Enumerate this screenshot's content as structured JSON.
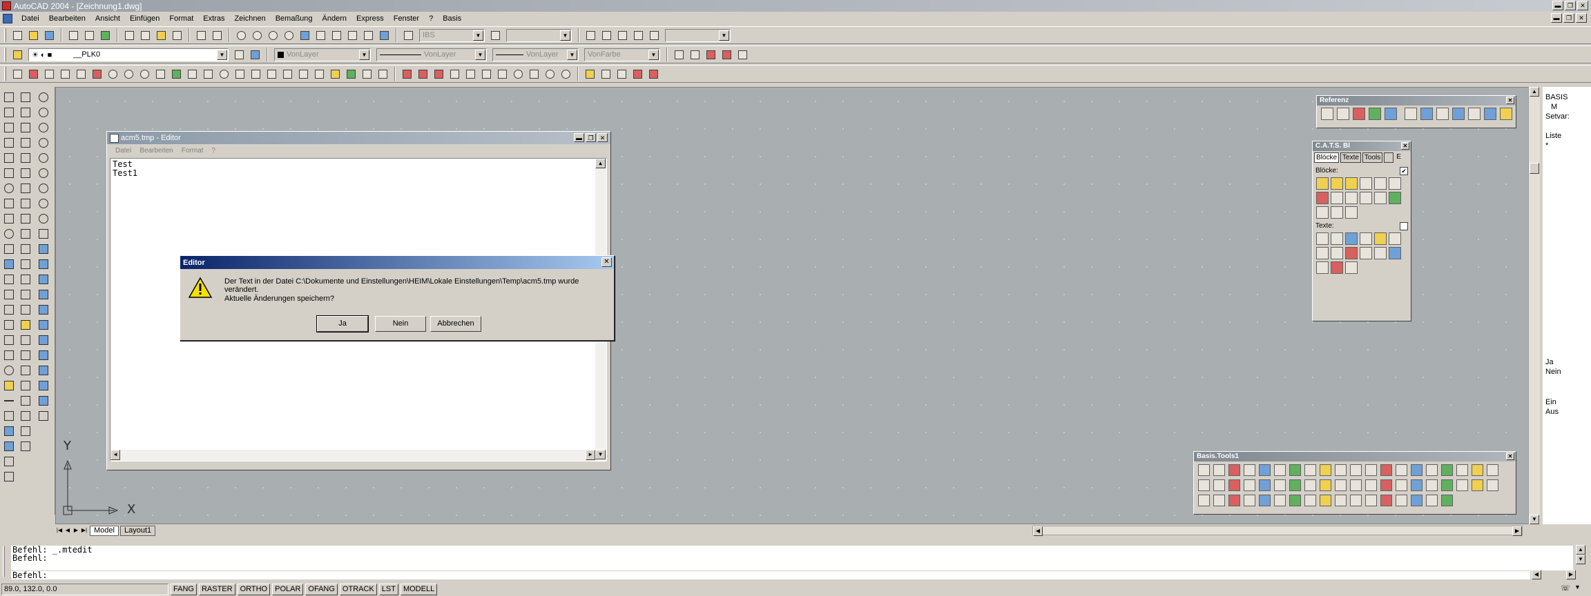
{
  "window": {
    "title": "AutoCAD 2004 - [Zeichnung1.dwg]",
    "controls": [
      "▬",
      "❐",
      "✕"
    ]
  },
  "menu": {
    "items": [
      "Datei",
      "Bearbeiten",
      "Ansicht",
      "Einfügen",
      "Format",
      "Extras",
      "Zeichnen",
      "Bemaßung",
      "Ändern",
      "Express",
      "Fenster",
      "?",
      "Basis"
    ]
  },
  "toolbars": {
    "text_style": "IBS",
    "layer": "__PLK0",
    "color": "VonLayer",
    "linetype": "VonLayer",
    "lineweight": "VonLayer",
    "plotstyle": "VonFarbe"
  },
  "editor": {
    "title": "acm5.tmp - Editor",
    "menu": [
      "Datei",
      "Bearbeiten",
      "Format",
      "?"
    ],
    "lines": [
      "Test",
      "Test1"
    ]
  },
  "dialog": {
    "title": "Editor",
    "message": "Der Text in der Datei C:\\Dokumente und Einstellungen\\HEIM\\Lokale Einstellungen\\Temp\\acm5.tmp wurde verändert.",
    "question": "Aktuelle Änderungen speichern?",
    "buttons": {
      "yes": "Ja",
      "no": "Nein",
      "cancel": "Abbrechen"
    }
  },
  "palettes": {
    "referenz": {
      "title": "Referenz"
    },
    "cats": {
      "title": "C.A.T.S. Bl",
      "tabs": [
        "Blöcke",
        "Texte",
        "Tools",
        "",
        "E"
      ],
      "bloecke_label": "Blöcke:",
      "texte_label": "Texte:"
    },
    "basis_tools": {
      "title": "Basis.Tools1"
    }
  },
  "right_panel": {
    "lines": [
      "BASIS",
      "M",
      "Setvar:",
      "",
      "Liste",
      "*"
    ],
    "yn": [
      "Ja",
      "Nein"
    ],
    "onoff": [
      "Ein",
      "Aus"
    ]
  },
  "layout_tabs": [
    "Model",
    "Layout1"
  ],
  "ucs": {
    "x": "X",
    "y": "Y"
  },
  "command": {
    "lines": [
      "Befehl: _.mtedit",
      "Befehl:",
      "Befehl:"
    ]
  },
  "status": {
    "coords": "89.0, 132.0, 0.0",
    "toggles": [
      "FANG",
      "RASTER",
      "ORTHO",
      "POLAR",
      "OFANG",
      "OTRACK",
      "LST",
      "MODELL"
    ]
  },
  "colors": {
    "dialog_title": "#0a246a",
    "drawing_bg": "#a9aeb0"
  }
}
